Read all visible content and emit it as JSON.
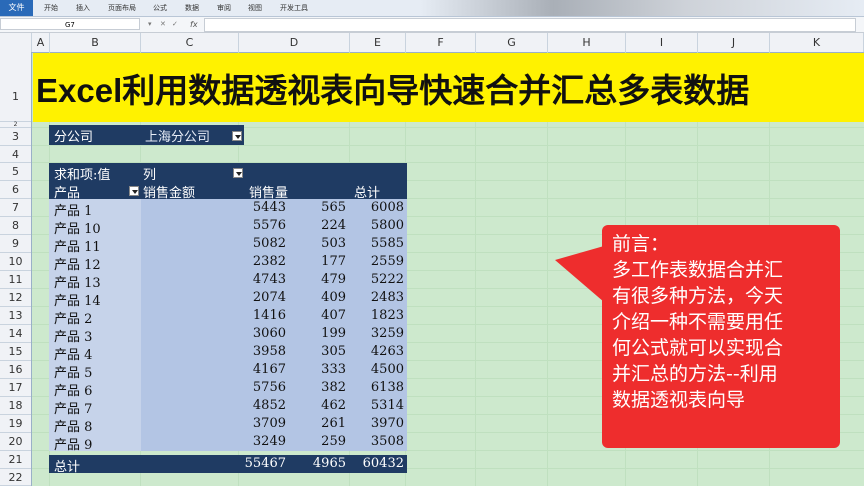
{
  "ribbon": {
    "file": "文件",
    "tabs": [
      "开始",
      "插入",
      "页面布局",
      "公式",
      "数据",
      "审阅",
      "视图",
      "开发工具"
    ]
  },
  "formula_bar": {
    "name_box": "G7",
    "fx": "fx"
  },
  "columns": [
    "A",
    "B",
    "C",
    "D",
    "E",
    "F",
    "G",
    "H",
    "I",
    "J",
    "K"
  ],
  "rows": [
    "1",
    "2",
    "3",
    "4",
    "5",
    "6",
    "7",
    "8",
    "9",
    "10",
    "11",
    "12",
    "13",
    "14",
    "15",
    "16",
    "17",
    "18",
    "19",
    "20",
    "21",
    "22"
  ],
  "title": "Excel利用数据透视表向导快速合并汇总多表数据",
  "filter": {
    "label": "分公司",
    "value": "上海分公司"
  },
  "pivot": {
    "header1": "求和项:值",
    "header1_col": "列",
    "row_label": "产品",
    "columns": [
      "销售金额",
      "销售量",
      "总计"
    ],
    "rows": [
      {
        "name": "产品 1",
        "amount": "5443",
        "qty": "565",
        "total": "6008"
      },
      {
        "name": "产品 10",
        "amount": "5576",
        "qty": "224",
        "total": "5800"
      },
      {
        "name": "产品 11",
        "amount": "5082",
        "qty": "503",
        "total": "5585"
      },
      {
        "name": "产品 12",
        "amount": "2382",
        "qty": "177",
        "total": "2559"
      },
      {
        "name": "产品 13",
        "amount": "4743",
        "qty": "479",
        "total": "5222"
      },
      {
        "name": "产品 14",
        "amount": "2074",
        "qty": "409",
        "total": "2483"
      },
      {
        "name": "产品 2",
        "amount": "1416",
        "qty": "407",
        "total": "1823"
      },
      {
        "name": "产品 3",
        "amount": "3060",
        "qty": "199",
        "total": "3259"
      },
      {
        "name": "产品 4",
        "amount": "3958",
        "qty": "305",
        "total": "4263"
      },
      {
        "name": "产品 5",
        "amount": "4167",
        "qty": "333",
        "total": "4500"
      },
      {
        "name": "产品 6",
        "amount": "5756",
        "qty": "382",
        "total": "6138"
      },
      {
        "name": "产品 7",
        "amount": "4852",
        "qty": "462",
        "total": "5314"
      },
      {
        "name": "产品 8",
        "amount": "3709",
        "qty": "261",
        "total": "3970"
      },
      {
        "name": "产品 9",
        "amount": "3249",
        "qty": "259",
        "total": "3508"
      }
    ],
    "total": {
      "name": "总计",
      "amount": "55467",
      "qty": "4965",
      "total": "60432"
    }
  },
  "callout": {
    "lines": [
      "前言：",
      "多工作表数据合并汇",
      "有很多种方法，今天",
      "介绍一种不需要用任",
      "何公式就可以实现合",
      "并汇总的方法--利用",
      "数据透视表向导"
    ],
    "color": "#ee2d2d"
  }
}
